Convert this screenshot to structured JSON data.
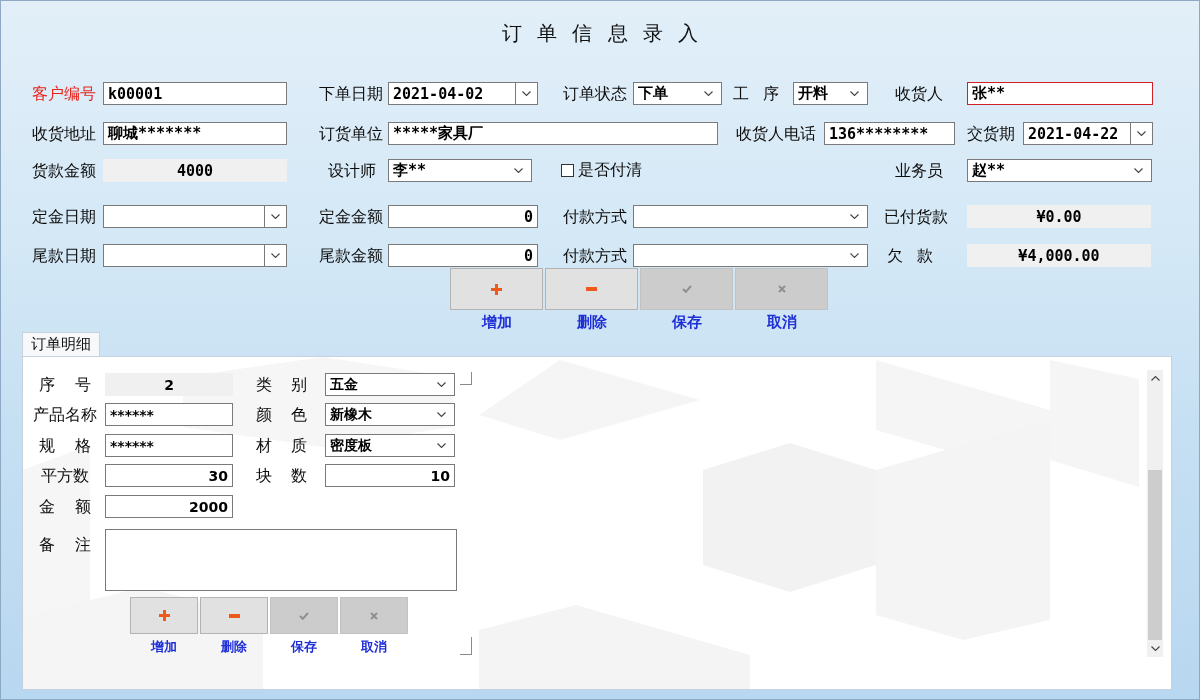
{
  "window": {
    "title": "订 单 信 息 录 入"
  },
  "order_form": {
    "rows": [
      [
        {
          "label": "客户编号",
          "required": true,
          "kind": "text",
          "value": "k00001",
          "focused": false
        },
        {
          "label": "下单日期",
          "required": false,
          "kind": "date",
          "value": "2021-04-02",
          "focused": false
        },
        {
          "label": "订单状态",
          "required": false,
          "kind": "combo",
          "value": "下单",
          "focused": false
        },
        {
          "label": "工 序",
          "required": false,
          "kind": "combo",
          "value": "开料",
          "focused": false
        },
        {
          "label": "收货人",
          "required": false,
          "kind": "text",
          "value": "张**",
          "focused": true
        }
      ],
      [
        {
          "label": "收货地址",
          "required": false,
          "kind": "text",
          "value": "聊城*******",
          "focused": false
        },
        {
          "label": "订货单位",
          "required": false,
          "kind": "text",
          "value": "*****家具厂",
          "focused": false
        },
        {
          "label": "收货人电话",
          "required": false,
          "kind": "text",
          "value": "136********",
          "focused": false
        },
        {
          "label": "交货期",
          "required": false,
          "kind": "date",
          "value": "2021-04-22",
          "focused": false
        }
      ],
      [
        {
          "label": "货款金额",
          "required": false,
          "kind": "readonly",
          "value": "4000",
          "focused": false
        },
        {
          "label": "设计师",
          "required": false,
          "kind": "combo",
          "value": "李**",
          "focused": false
        },
        {
          "label": "是否付清",
          "kind": "checkbox",
          "checked": false,
          "focused": false
        },
        {
          "label": "业务员",
          "required": false,
          "kind": "combo",
          "value": "赵**",
          "focused": false
        }
      ],
      [
        {
          "label": "定金日期",
          "required": false,
          "kind": "date",
          "focused": false
        },
        {
          "label": "定金金额",
          "required": false,
          "kind": "number",
          "value": "0",
          "focused": false
        },
        {
          "label": "付款方式",
          "required": false,
          "kind": "combo",
          "focused": false
        },
        {
          "label": "已付货款",
          "required": false,
          "kind": "readonly",
          "value": "¥0.00",
          "focused": false
        }
      ],
      [
        {
          "label": "尾款日期",
          "required": false,
          "kind": "date",
          "focused": false
        },
        {
          "label": "尾款金额",
          "required": false,
          "kind": "number",
          "value": "0",
          "focused": false
        },
        {
          "label": "付款方式",
          "required": false,
          "kind": "combo",
          "focused": false
        },
        {
          "label": "欠 款",
          "required": false,
          "kind": "readonly",
          "value": "¥4,000.00",
          "focused": false
        }
      ]
    ]
  },
  "order_actions": [
    {
      "kind": "add",
      "caption": "增加",
      "disabled": false
    },
    {
      "kind": "remove",
      "caption": "删除",
      "disabled": false
    },
    {
      "kind": "save",
      "caption": "保存",
      "disabled": true
    },
    {
      "kind": "cancel",
      "caption": "取消",
      "disabled": true
    }
  ],
  "detail_tabs": [
    {
      "label": "订单明细",
      "selected": true
    }
  ],
  "detail_form": {
    "rows": [
      [
        {
          "label": "序 号",
          "kind": "readonly",
          "value": "2"
        },
        {
          "label": "类 别",
          "kind": "combo",
          "value": "五金"
        }
      ],
      [
        {
          "label": "产品名称",
          "kind": "text",
          "value": "******"
        },
        {
          "label": "颜 色",
          "kind": "combo",
          "value": "新橡木"
        }
      ],
      [
        {
          "label": "规 格",
          "kind": "text",
          "value": "******"
        },
        {
          "label": "材 质",
          "kind": "combo",
          "value": "密度板"
        }
      ],
      [
        {
          "label": "平方数",
          "kind": "number",
          "value": "30"
        },
        {
          "label": "块 数",
          "kind": "number",
          "value": "10"
        }
      ],
      [
        {
          "label": "金 额",
          "kind": "number",
          "value": "2000"
        }
      ]
    ],
    "remarks": {
      "label": "备 注"
    }
  },
  "detail_actions": [
    {
      "kind": "add",
      "caption": "增加",
      "disabled": false
    },
    {
      "kind": "remove",
      "caption": "删除",
      "disabled": false
    },
    {
      "kind": "save",
      "caption": "保存",
      "disabled": true
    },
    {
      "kind": "cancel",
      "caption": "取消",
      "disabled": true
    }
  ]
}
